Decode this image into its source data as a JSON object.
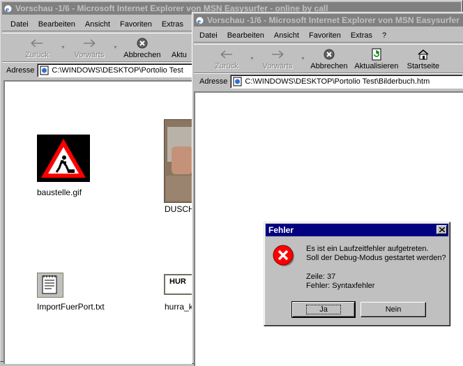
{
  "back_window": {
    "title": "Vorschau -1/6 - Microsoft Internet Explorer von MSN Easysurfer - online by call",
    "menu": [
      "Datei",
      "Bearbeiten",
      "Ansicht",
      "Favoriten",
      "Extras"
    ],
    "toolbar": {
      "back": "Zurück",
      "forward": "Vorwärts",
      "stop": "Abbrechen",
      "refresh": "Aktu"
    },
    "address_label": "Adresse",
    "address_value": "C:\\WINDOWS\\DESKTOP\\Portolio Test",
    "files": [
      {
        "name": "baustelle.gif"
      },
      {
        "name": "DUSCH"
      },
      {
        "name": "ImportFuerPort.txt"
      },
      {
        "name": "hurra_k"
      }
    ]
  },
  "front_window": {
    "title": "Vorschau -1/6 - Microsoft Internet Explorer von MSN Easysurfer",
    "menu": [
      "Datei",
      "Bearbeiten",
      "Ansicht",
      "Favoriten",
      "Extras",
      "?"
    ],
    "toolbar": {
      "back": "Zurück",
      "forward": "Vorwärts",
      "stop": "Abbrechen",
      "refresh": "Aktualisieren",
      "home": "Startseite"
    },
    "address_label": "Adresse",
    "address_value": "C:\\WINDOWS\\DESKTOP\\Portolio Test\\Bilderbuch.htm"
  },
  "dialog": {
    "title": "Fehler",
    "message_line1": "Es ist ein Laufzeitfehler aufgetreten.",
    "message_line2": "Soll der Debug-Modus gestartet werden?",
    "line_label": "Zeile: 37",
    "error_label": "Fehler: Syntaxfehler",
    "yes_button": "Ja",
    "no_button": "Nein"
  },
  "hurra_thumb_text": "HUR"
}
